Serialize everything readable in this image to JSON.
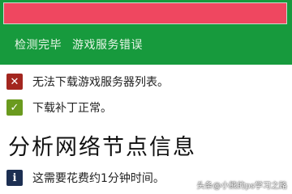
{
  "progress": {
    "value_percent": 100,
    "fill_color": "#ef4760"
  },
  "header": {
    "background_color": "#179a3d",
    "status_left": "检测完毕",
    "status_right": "游戏服务错误"
  },
  "messages": [
    {
      "icon": "error-x-icon",
      "text": "无法下载游戏服务器列表。"
    },
    {
      "icon": "checkmark-icon",
      "text": "下载补丁正常。"
    }
  ],
  "section": {
    "title": "分析网络节点信息"
  },
  "info": {
    "icon": "info-icon",
    "text": "这需要花费约1分钟时间。"
  },
  "watermark": "头条@小熊的ps学习之路"
}
